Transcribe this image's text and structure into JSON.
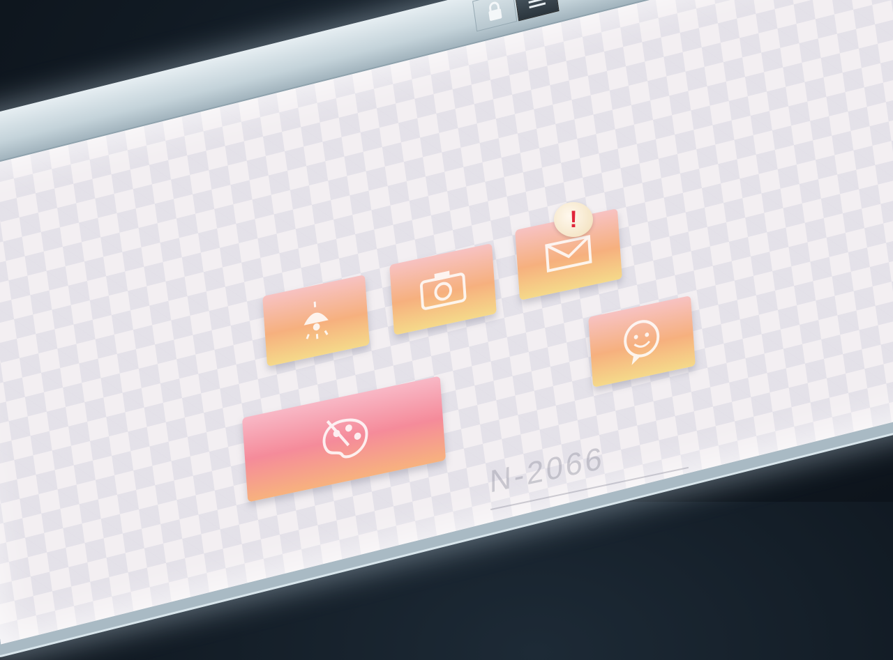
{
  "device": {
    "model_label": "N-2066",
    "topbar": {
      "lock_icon": "lock-icon",
      "menu_icon": "menu-icon"
    }
  },
  "apps": [
    {
      "id": "lamp",
      "icon": "lamp-icon",
      "label": ""
    },
    {
      "id": "camera",
      "icon": "camera-icon",
      "label": ""
    },
    {
      "id": "mail",
      "icon": "mail-icon",
      "label": "",
      "badge": "!"
    },
    {
      "id": "chat",
      "icon": "chat-face-icon",
      "label": ""
    },
    {
      "id": "paint",
      "icon": "paint-palette-icon",
      "label": ""
    }
  ],
  "colors": {
    "tile_orange_top": "#f7c2c2",
    "tile_orange_bottom": "#f5d98a",
    "tile_pink": "#f58b9a",
    "badge_red": "#e0253a",
    "background": "#111a23"
  }
}
